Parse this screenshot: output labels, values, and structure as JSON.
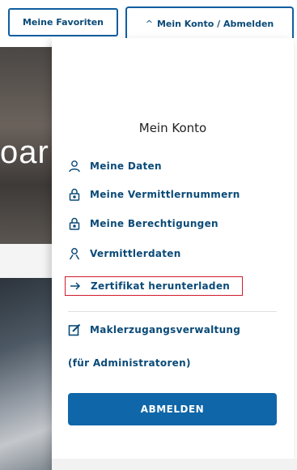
{
  "header": {
    "favorites_label": "Meine Favoriten",
    "account_label": "Mein Konto / Abmelden",
    "account_chevron": "^"
  },
  "hero": {
    "partial_text": "oar"
  },
  "dropdown": {
    "title": "Mein Konto",
    "items": [
      {
        "label": "Meine Daten",
        "icon": "person-icon"
      },
      {
        "label": "Meine Vermittlernummern",
        "icon": "lock-icon"
      },
      {
        "label": "Meine Berechtigungen",
        "icon": "lock-icon"
      },
      {
        "label": "Vermittlerdaten",
        "icon": "person-icon"
      },
      {
        "label": "Zertifikat herunterladen",
        "icon": "arrow-right-icon",
        "highlighted": true
      }
    ],
    "admin_item": {
      "label": "Maklerzugangsverwaltung",
      "icon": "edit-icon"
    },
    "admin_note": "(für Administratoren)",
    "logout_label": "ABMELDEN"
  },
  "colors": {
    "brand_blue": "#0f66a8",
    "text_blue": "#0a4a78",
    "highlight_red": "#d11b2e"
  }
}
